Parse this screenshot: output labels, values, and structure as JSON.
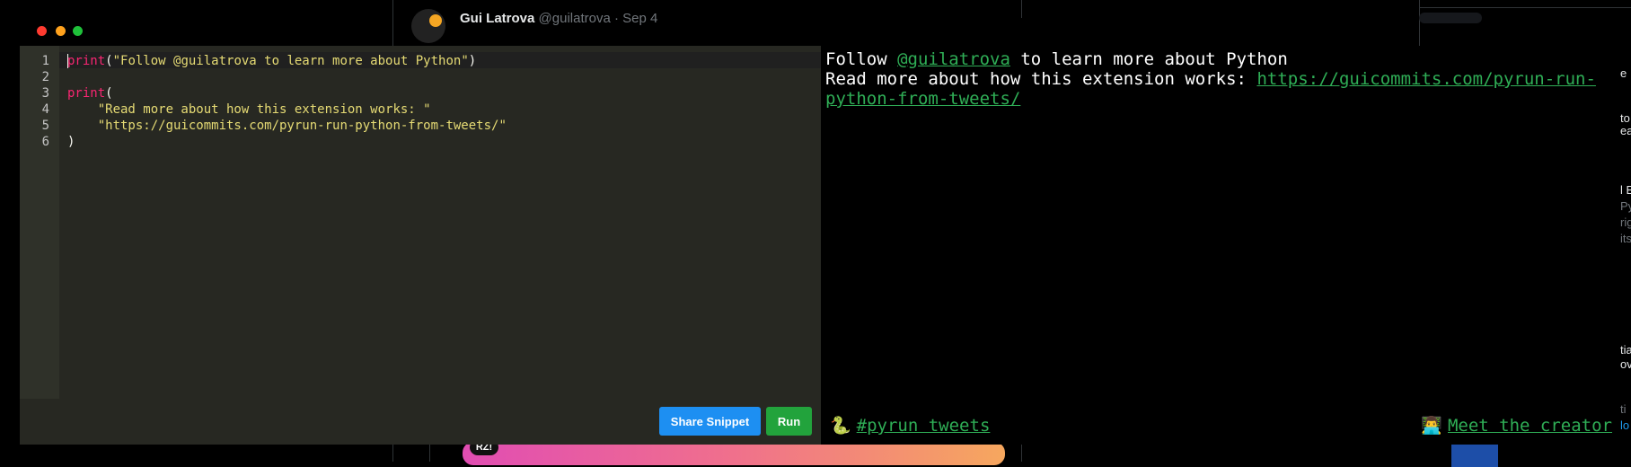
{
  "background": {
    "tweet_author": "Gui Latrova",
    "tweet_handle": "@guilatrova · Sep 4",
    "badge": "RZ!",
    "right_fragments": [
      "e",
      "to",
      "ea",
      "l E",
      "Py",
      "rig",
      "its",
      "tia",
      "ov",
      "ti",
      "lo"
    ]
  },
  "editor": {
    "line_numbers": [
      "1",
      "2",
      "3",
      "4",
      "5",
      "6"
    ],
    "lines": [
      {
        "kw": "print",
        "rest": "(",
        "str": "\"Follow @guilatrova to learn more about Python\"",
        "tail": ")"
      },
      {
        "kw": "",
        "rest": "",
        "str": "",
        "tail": ""
      },
      {
        "kw": "print",
        "rest": "(",
        "str": "",
        "tail": ""
      },
      {
        "kw": "",
        "rest": "    ",
        "str": "\"Read more about how this extension works: \"",
        "tail": ""
      },
      {
        "kw": "",
        "rest": "    ",
        "str": "\"https://guicommits.com/pyrun-run-python-from-tweets/\"",
        "tail": ""
      },
      {
        "kw": "",
        "rest": ")",
        "str": "",
        "tail": ""
      }
    ]
  },
  "buttons": {
    "share_label": "Share Snippet",
    "run_label": "Run"
  },
  "output": {
    "line1_prefix": "Follow ",
    "line1_link": "@guilatrova",
    "line1_suffix": " to learn more about Python",
    "line2_prefix": "Read more about how this extension works: ",
    "line2_link_part1": "https://guicommits.com/pyrun-run-",
    "line2_link_part2": "python-from-tweets/"
  },
  "footer": {
    "tweets_emoji": "🐍",
    "tweets_label": "#pyrun tweets",
    "creator_emoji": "👨‍💻",
    "creator_label": "Meet the creator"
  },
  "colors": {
    "editor_bg": "#272822",
    "keyword": "#f92672",
    "string": "#e6db74",
    "link": "#2fae56",
    "share_button": "#1d8ff2",
    "run_button": "#22a33c"
  }
}
